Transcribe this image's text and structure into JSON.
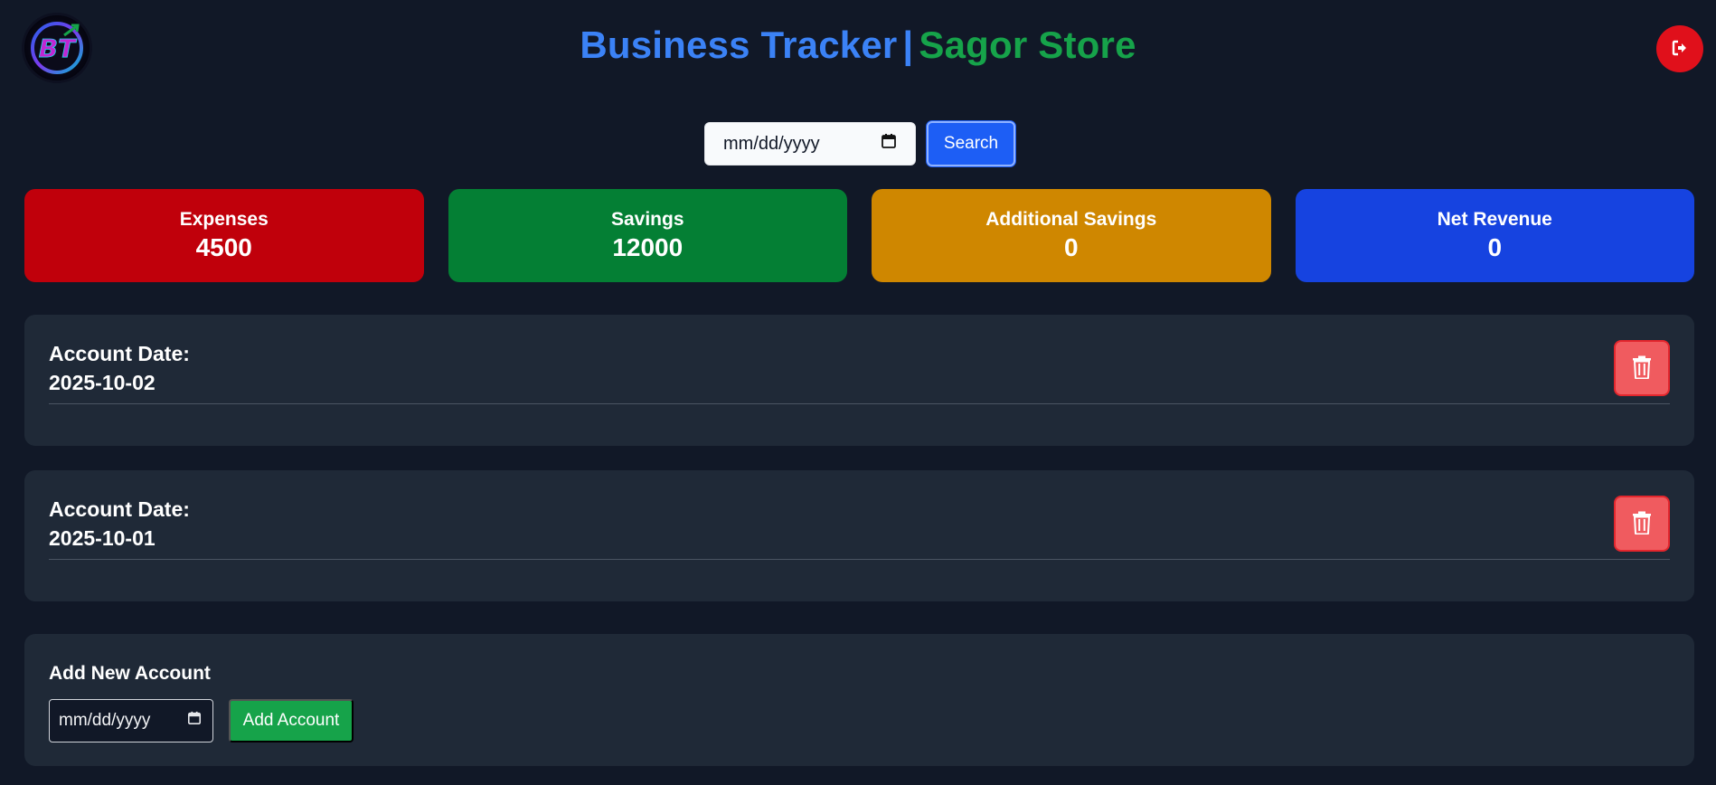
{
  "header": {
    "app_name": "Business Tracker",
    "separator": "|",
    "store_name": "Sagor Store",
    "logo_icon": "bt-logo-icon",
    "logout_icon": "logout-icon"
  },
  "search": {
    "date_placeholder": "mm/dd/yyyy",
    "button_label": "Search"
  },
  "stats": [
    {
      "label": "Expenses",
      "value": "4500",
      "color": "#c0000b"
    },
    {
      "label": "Savings",
      "value": "12000",
      "color": "#047f34"
    },
    {
      "label": "Additional Savings",
      "value": "0",
      "color": "#cf8700"
    },
    {
      "label": "Net Revenue",
      "value": "0",
      "color": "#1643e0"
    }
  ],
  "accounts": [
    {
      "label": "Account Date:",
      "date": "2025-10-02",
      "delete_icon": "trash-icon"
    },
    {
      "label": "Account Date:",
      "date": "2025-10-01",
      "delete_icon": "trash-icon"
    }
  ],
  "add_account": {
    "title": "Add New Account",
    "date_placeholder": "mm/dd/yyyy",
    "button_label": "Add Account"
  },
  "colors": {
    "background": "#111827",
    "card": "#1f2937",
    "primary": "#3b82f6",
    "success": "#16a34a",
    "danger": "#e0101b"
  }
}
